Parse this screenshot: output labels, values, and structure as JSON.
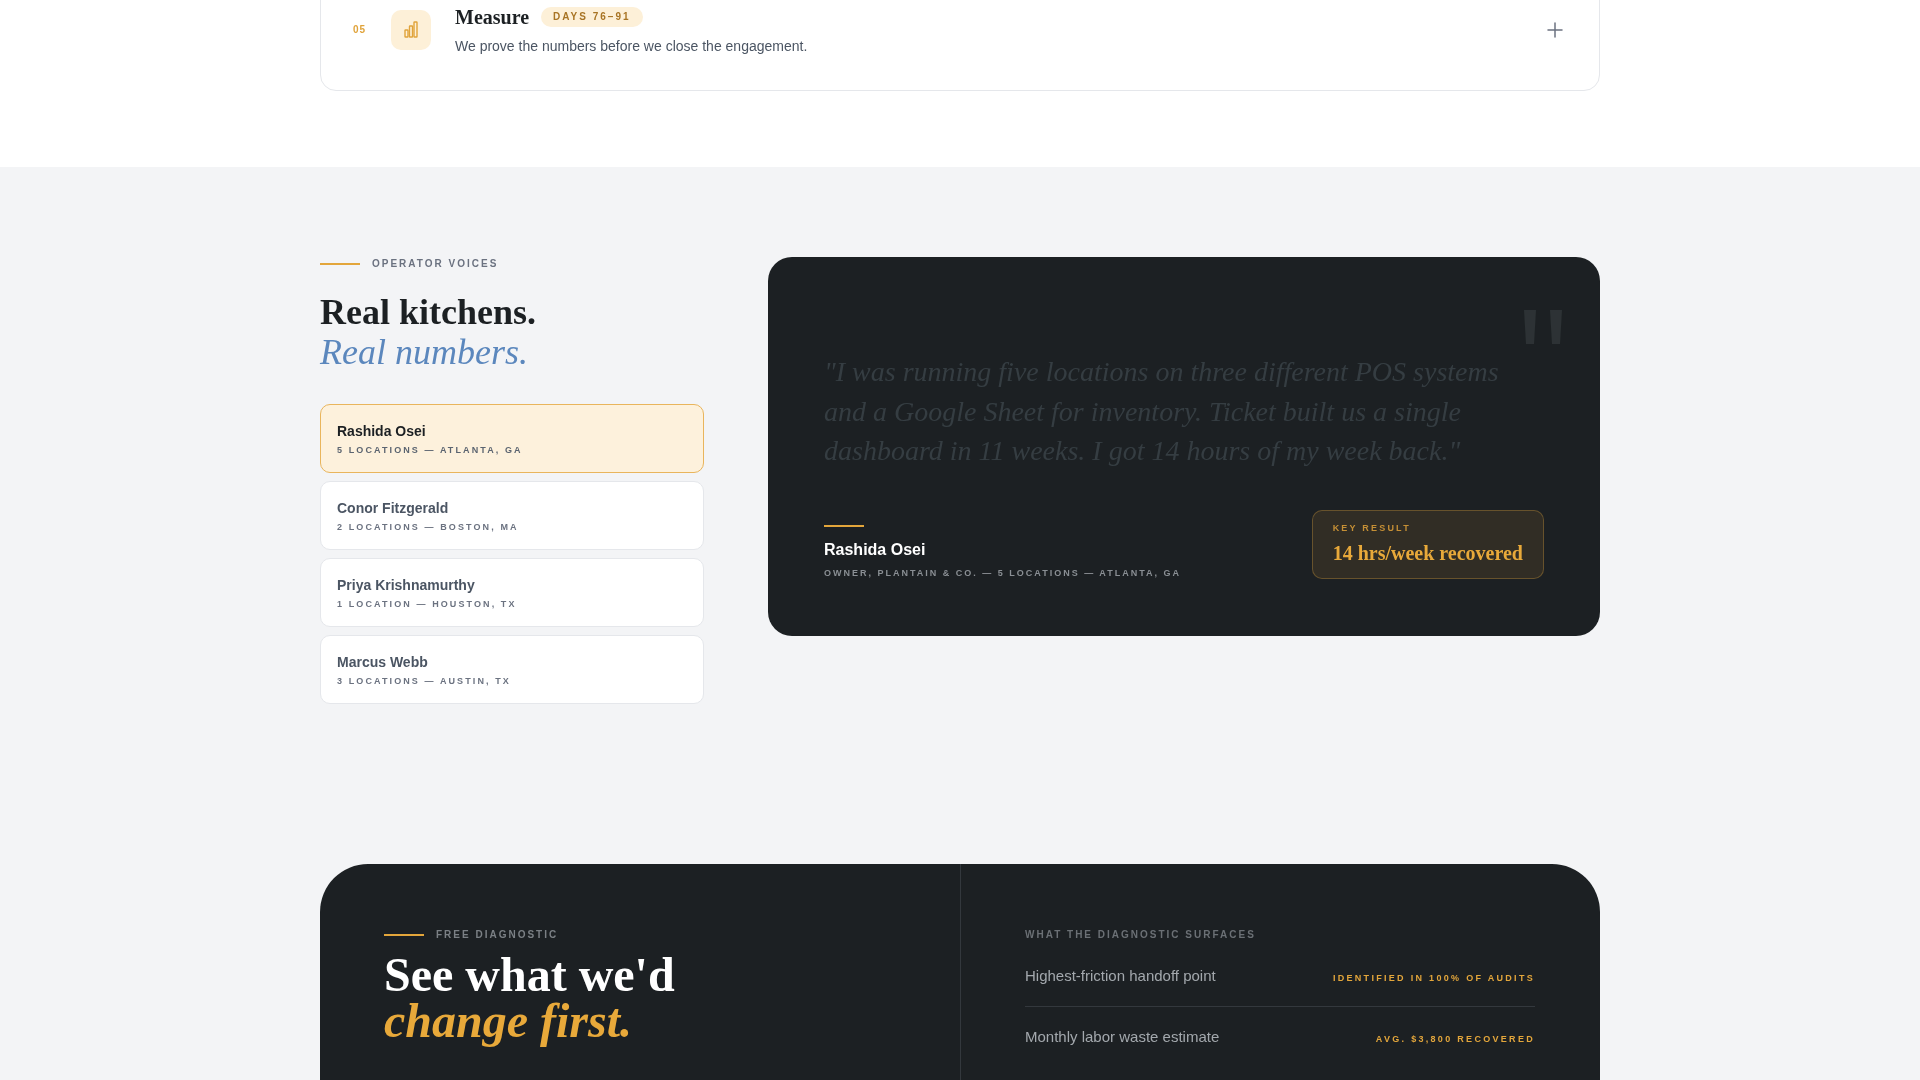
{
  "process_step": {
    "number": "05",
    "title": "Measure",
    "badge": "DAYS 76–91",
    "description": "We prove the numbers before we close the engagement.",
    "expanded": false
  },
  "testimonials": {
    "eyebrow": "OPERATOR VOICES",
    "heading": "Real kitchens.",
    "heading_accent": "Real numbers.",
    "operators": [
      {
        "name": "Rashida Osei",
        "detail": "5 LOCATIONS — ATLANTA, GA",
        "selected": true
      },
      {
        "name": "Conor Fitzgerald",
        "detail": "2 LOCATIONS — BOSTON, MA",
        "selected": false
      },
      {
        "name": "Priya Krishnamurthy",
        "detail": "1 LOCATION — HOUSTON, TX",
        "selected": false
      },
      {
        "name": "Marcus Webb",
        "detail": "3 LOCATIONS — AUSTIN, TX",
        "selected": false
      }
    ]
  },
  "featured_quote": {
    "quote": "\"I was running five locations on three different POS systems and a Google Sheet for inventory. Ticket built us a single dashboard in 11 weeks. I got 14 hours of my week back.\"",
    "author": "Rashida Osei",
    "role": "OWNER, PLANTAIN & CO. — 5 LOCATIONS — ATLANTA, GA",
    "result_label": "KEY RESULT",
    "result": "14 hrs/week recovered"
  },
  "diagnostic": {
    "eyebrow": "FREE DIAGNOSTIC",
    "heading": "See what we'd",
    "heading_accent": "change first.",
    "surfaces_title": "WHAT THE DIAGNOSTIC SURFACES",
    "findings": [
      {
        "label": "Highest-friction handoff point",
        "stat": "IDENTIFIED IN 100% OF AUDITS"
      },
      {
        "label": "Monthly labor waste estimate",
        "stat": "AVG. $3,800 RECOVERED"
      }
    ]
  }
}
